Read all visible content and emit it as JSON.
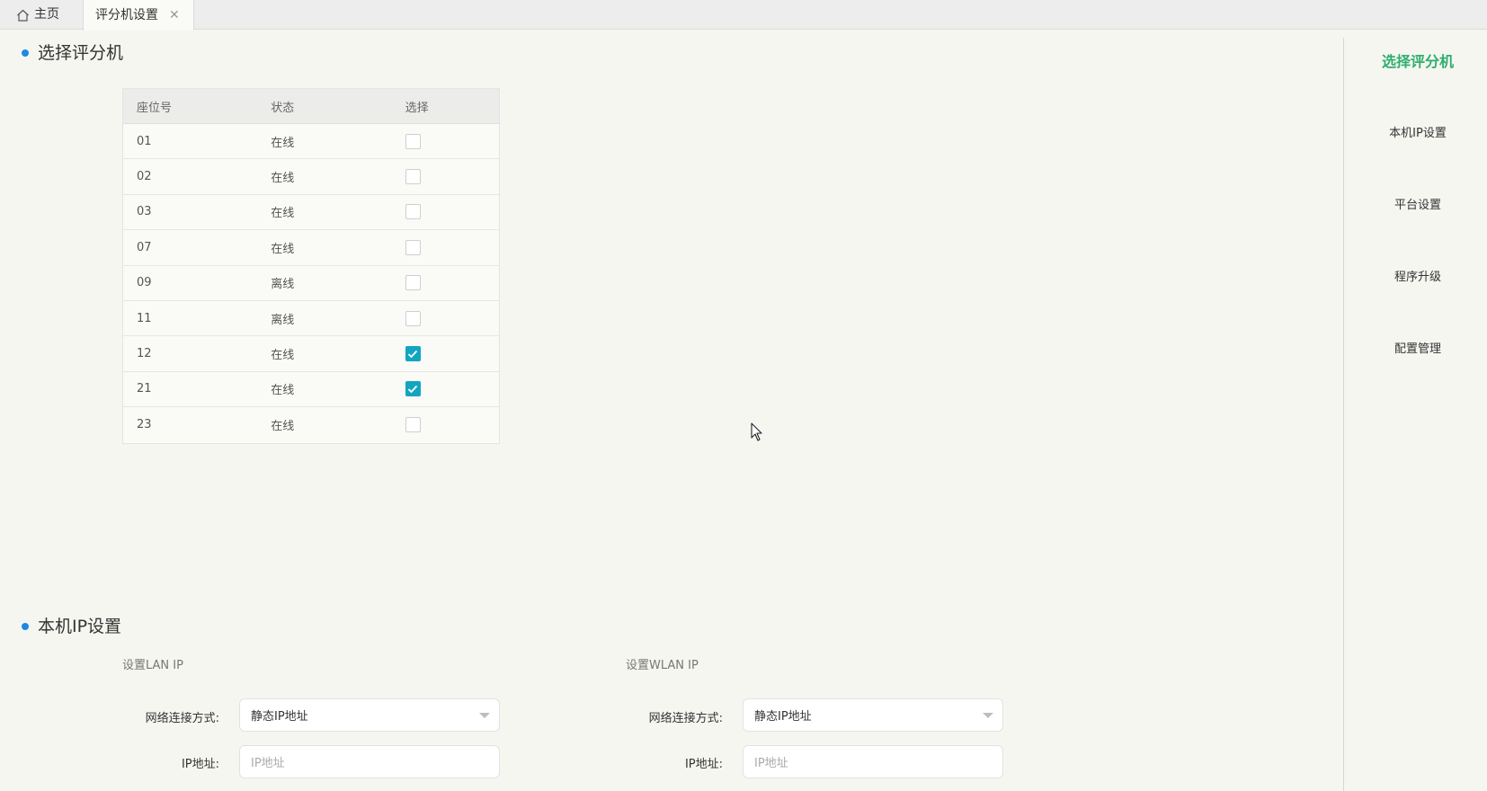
{
  "tabs": {
    "home_label": "主页",
    "active_label": "评分机设置",
    "close_symbol": "✕"
  },
  "section_select": {
    "title": "选择评分机",
    "table": {
      "headers": [
        "座位号",
        "状态",
        "选择"
      ],
      "rows": [
        {
          "seat": "01",
          "status": "在线",
          "checked": false
        },
        {
          "seat": "02",
          "status": "在线",
          "checked": false
        },
        {
          "seat": "03",
          "status": "在线",
          "checked": false
        },
        {
          "seat": "07",
          "status": "在线",
          "checked": false
        },
        {
          "seat": "09",
          "status": "离线",
          "checked": false
        },
        {
          "seat": "11",
          "status": "离线",
          "checked": false
        },
        {
          "seat": "12",
          "status": "在线",
          "checked": true
        },
        {
          "seat": "21",
          "status": "在线",
          "checked": true
        },
        {
          "seat": "23",
          "status": "在线",
          "checked": false
        }
      ]
    }
  },
  "section_ip": {
    "title": "本机IP设置",
    "lan": {
      "heading": "设置LAN IP",
      "mode_label": "网络连接方式:",
      "mode_value": "静态IP地址",
      "ip_label": "IP地址:",
      "ip_placeholder": "IP地址"
    },
    "wlan": {
      "heading": "设置WLAN IP",
      "mode_label": "网络连接方式:",
      "mode_value": "静态IP地址",
      "ip_label": "IP地址:",
      "ip_placeholder": "IP地址"
    }
  },
  "right_nav": {
    "items": [
      {
        "label": "选择评分机",
        "active": true
      },
      {
        "label": "本机IP设置",
        "active": false
      },
      {
        "label": "平台设置",
        "active": false
      },
      {
        "label": "程序升级",
        "active": false
      },
      {
        "label": "配置管理",
        "active": false
      }
    ]
  },
  "colors": {
    "accent_green": "#2eae6e",
    "checkbox_checked": "#13a5c0",
    "bullet_blue": "#1e88e5"
  }
}
